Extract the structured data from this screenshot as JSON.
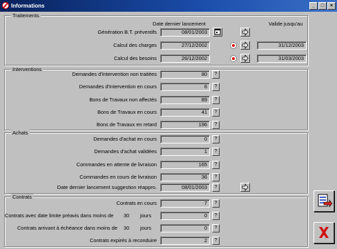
{
  "window": {
    "title": "Informations",
    "minimize_label": "_",
    "maximize_label": "□",
    "close_label": "×"
  },
  "traitements": {
    "label": "Traitements",
    "col_date": "Date dernier lancement",
    "col_valide": "Valide jusqu'au",
    "rows": [
      {
        "label": "Génération B.T. préventifs",
        "date": "08/01/2003",
        "valide": ""
      },
      {
        "label": "Calcul des charges",
        "date": "27/12/2002",
        "valide": "31/12/2003"
      },
      {
        "label": "Calcul des besoins",
        "date": "26/12/2002",
        "valide": "31/03/2003"
      }
    ]
  },
  "interventions": {
    "label": "Interventions",
    "rows": [
      {
        "label": "Demandes d'Intervention non traitées",
        "value": "80"
      },
      {
        "label": "Demandes d'Intervention en cours",
        "value": "6"
      },
      {
        "label": "Bons de Travaux non affectés",
        "value": "89"
      },
      {
        "label": "Bons de Travaux en cours",
        "value": "41"
      },
      {
        "label": "Bons de Travaux en retard",
        "value": "196"
      }
    ]
  },
  "achats": {
    "label": "Achats",
    "rows": [
      {
        "label": "Demandes d'achat en cours",
        "value": "0"
      },
      {
        "label": "Demandes d'achat validées",
        "value": "1"
      },
      {
        "label": "Commandes en attente de livraison",
        "value": "165"
      },
      {
        "label": "Commandes en cours de livraison",
        "value": "36"
      },
      {
        "label": "Date dernier lancement suggestion réappro.",
        "value": "08/01/2003"
      }
    ]
  },
  "contrats": {
    "label": "Contrats",
    "rows": [
      {
        "label": "Contrats en cours",
        "value": "7"
      },
      {
        "label": "Contrats avec date limite préavis dans moins de",
        "days": "30",
        "days_unit": "jours",
        "value": "0"
      },
      {
        "label": "Contrats arrivant à échéance dans moins de",
        "days": "30",
        "days_unit": "jours",
        "value": "0"
      },
      {
        "label": "Contrats expirés à reconduire",
        "value": "2"
      }
    ]
  },
  "question_label": "?",
  "colors": {
    "title_start": "#08215a",
    "title_end": "#3a6fc6",
    "accent_red": "#e00000",
    "window_bg": "#c0c0c0"
  }
}
